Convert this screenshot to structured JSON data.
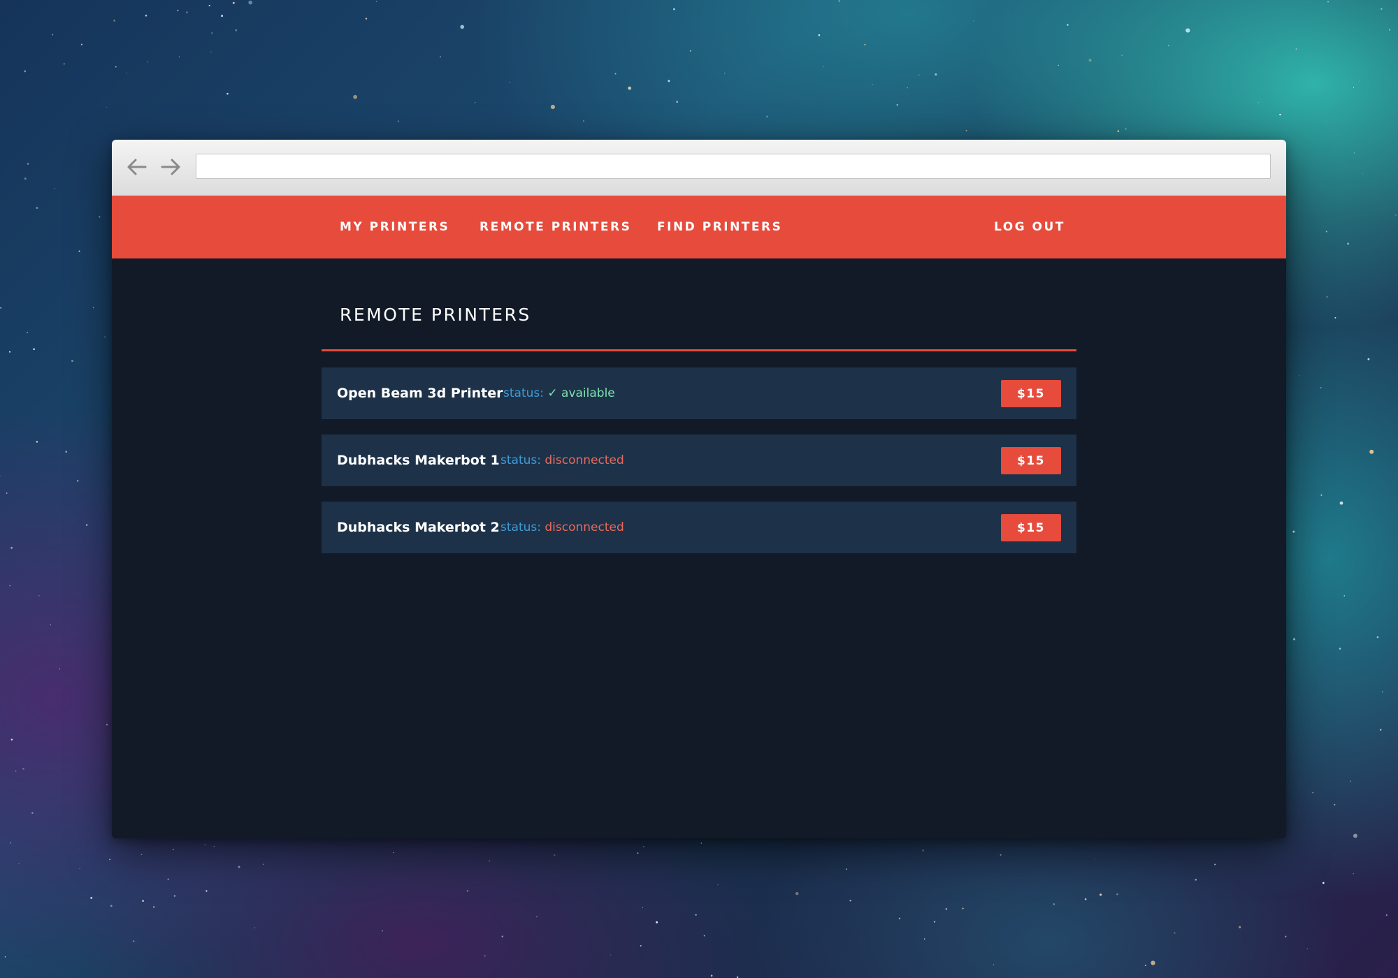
{
  "browser": {
    "url_value": "",
    "back_icon": "arrow-left-icon",
    "forward_icon": "arrow-right-icon"
  },
  "nav": {
    "my_printers": "MY PRINTERS",
    "remote_printers": "REMOTE PRINTERS",
    "find_printers": "FIND PRINTERS",
    "log_out": "LOG OUT"
  },
  "page": {
    "title": "REMOTE PRINTERS"
  },
  "printers": [
    {
      "name": "Open Beam 3d Printer",
      "status_label": "status:",
      "status_icon": "check-icon",
      "status_value": "✓ available",
      "price": "$15"
    },
    {
      "name": "Dubhacks Makerbot 1",
      "status_label": "status:",
      "status_value": "disconnected",
      "price": "$15"
    },
    {
      "name": "Dubhacks Makerbot 2",
      "status_label": "status:",
      "status_value": "disconnected",
      "price": "$15"
    }
  ],
  "colors": {
    "accent": "#e64b3c",
    "page_background": "#111a26",
    "row_background": "#1d3249",
    "status_label": "#3f9bd8",
    "status_available": "#7fe3b0",
    "status_disconnected": "#e86a5c"
  }
}
